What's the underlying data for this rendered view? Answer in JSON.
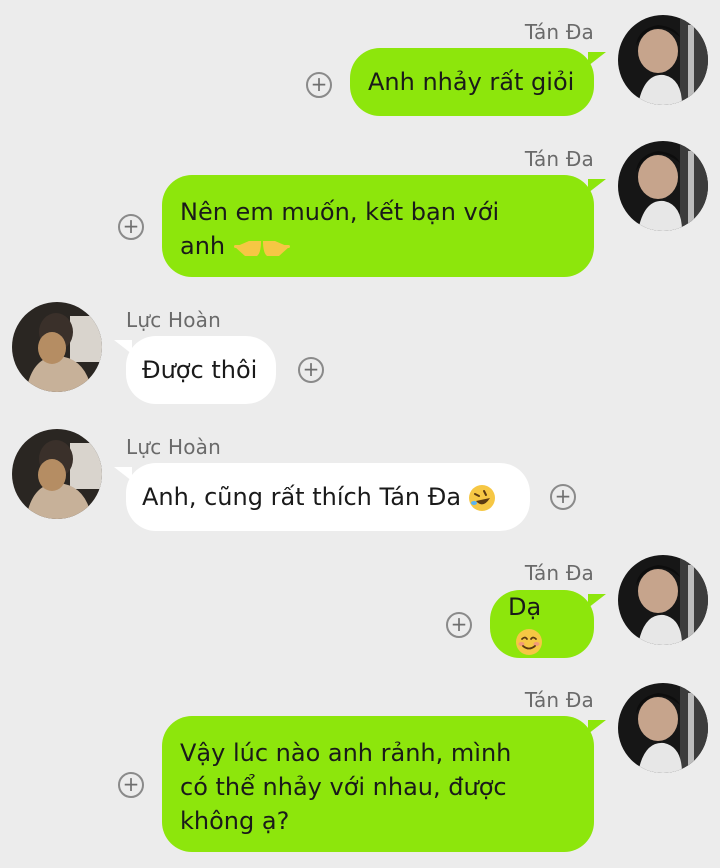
{
  "messages": [
    {
      "sender": "Tán Đa",
      "text": "Anh nhảy rất giỏi"
    },
    {
      "sender": "Tán Đa",
      "text": "Nên em muốn, kết bạn với\nanh",
      "emoji": "backhand-index-pointing-left-right-emoji"
    },
    {
      "sender": "Lực Hoàn",
      "text": "Được thôi"
    },
    {
      "sender": "Lực Hoàn",
      "text": "Anh, cũng rất thích Tán Đa",
      "emoji": "rolling-on-floor-laughing-emoji"
    },
    {
      "sender": "Tán Đa",
      "text": "Dạ",
      "emoji": "smiling-face-emoji"
    },
    {
      "sender": "Tán Đa",
      "text": "Vậy lúc nào anh rảnh, mình\ncó thể nhảy với nhau, được\nkhông ạ?"
    }
  ],
  "colors": {
    "background": "#ececec",
    "outgoing_bubble": "#8de60c",
    "incoming_bubble": "#ffffff"
  },
  "icons": {
    "add_reaction": "plus-circle-icon"
  }
}
